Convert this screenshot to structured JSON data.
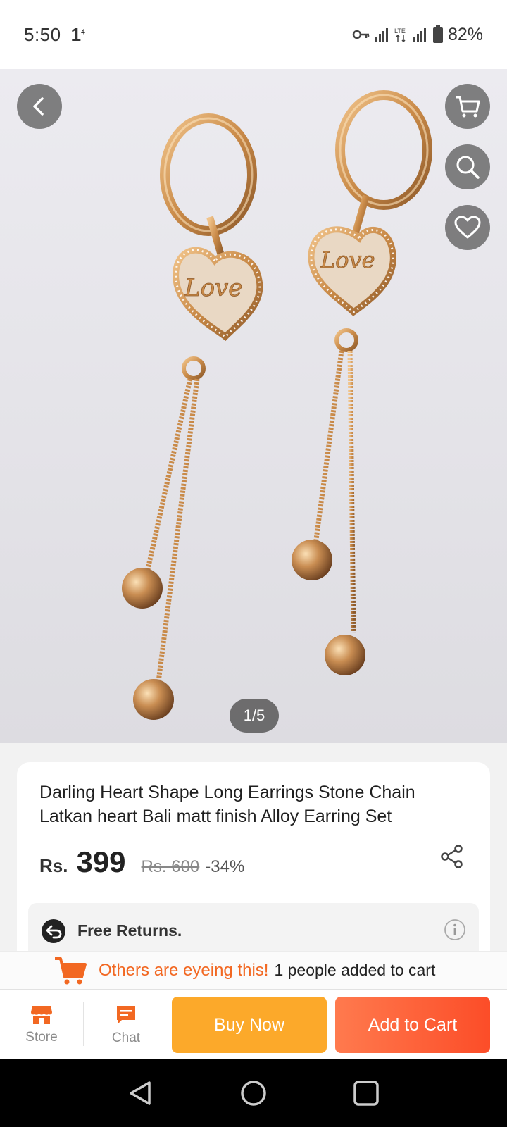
{
  "status_bar": {
    "time": "5:50",
    "sim_indicator": "1",
    "sim_sup": "4",
    "network": "LTE",
    "battery": "82%"
  },
  "gallery": {
    "counter": "1/5",
    "image_text": "Love"
  },
  "product": {
    "title": "Darling Heart Shape Long Earrings Stone Chain Latkan heart Bali matt finish Alloy Earring Set",
    "currency": "Rs.",
    "price": "399",
    "original_price": "Rs. 600",
    "discount": "-34%"
  },
  "returns": {
    "label": "Free Returns."
  },
  "banner": {
    "highlight": "Others are eyeing this!",
    "count_text": "1 people added to cart"
  },
  "bottom_bar": {
    "store_label": "Store",
    "chat_label": "Chat",
    "buy_now_label": "Buy Now",
    "add_to_cart_label": "Add to Cart"
  },
  "colors": {
    "accent_orange": "#f26822",
    "buy_now": "#fca92a",
    "add_to_cart": "#fc4d28"
  }
}
